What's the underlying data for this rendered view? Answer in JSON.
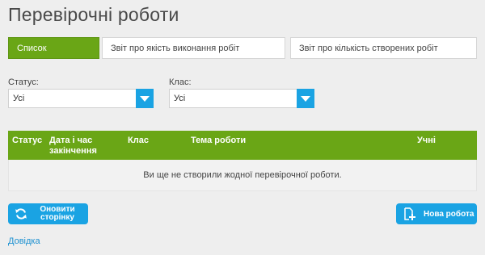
{
  "page": {
    "title": "Перевірочні роботи"
  },
  "tabs": [
    {
      "label": "Список",
      "active": true
    },
    {
      "label": "Звіт про якість виконання робіт",
      "active": false
    },
    {
      "label": "Звіт про кількість створених робіт",
      "active": false
    }
  ],
  "filters": {
    "status": {
      "label": "Статус:",
      "value": "Усі"
    },
    "class": {
      "label": "Клас:",
      "value": "Усі"
    }
  },
  "table": {
    "headers": [
      "Статус",
      "Дата і час закінчення",
      "Клас",
      "Тема роботи",
      "Учні"
    ],
    "empty_message": "Ви ще не створили жодної перевірочної роботи."
  },
  "buttons": {
    "refresh": "Оновити сторінку",
    "new_work": "Нова робота"
  },
  "help_link": "Довідка",
  "colors": {
    "accent_green": "#6aa616",
    "accent_blue": "#1aa3e3",
    "link": "#1a8fd0"
  },
  "icons": {
    "refresh": "refresh-icon",
    "new_work": "add-document-icon",
    "dropdown": "chevron-down-icon"
  }
}
